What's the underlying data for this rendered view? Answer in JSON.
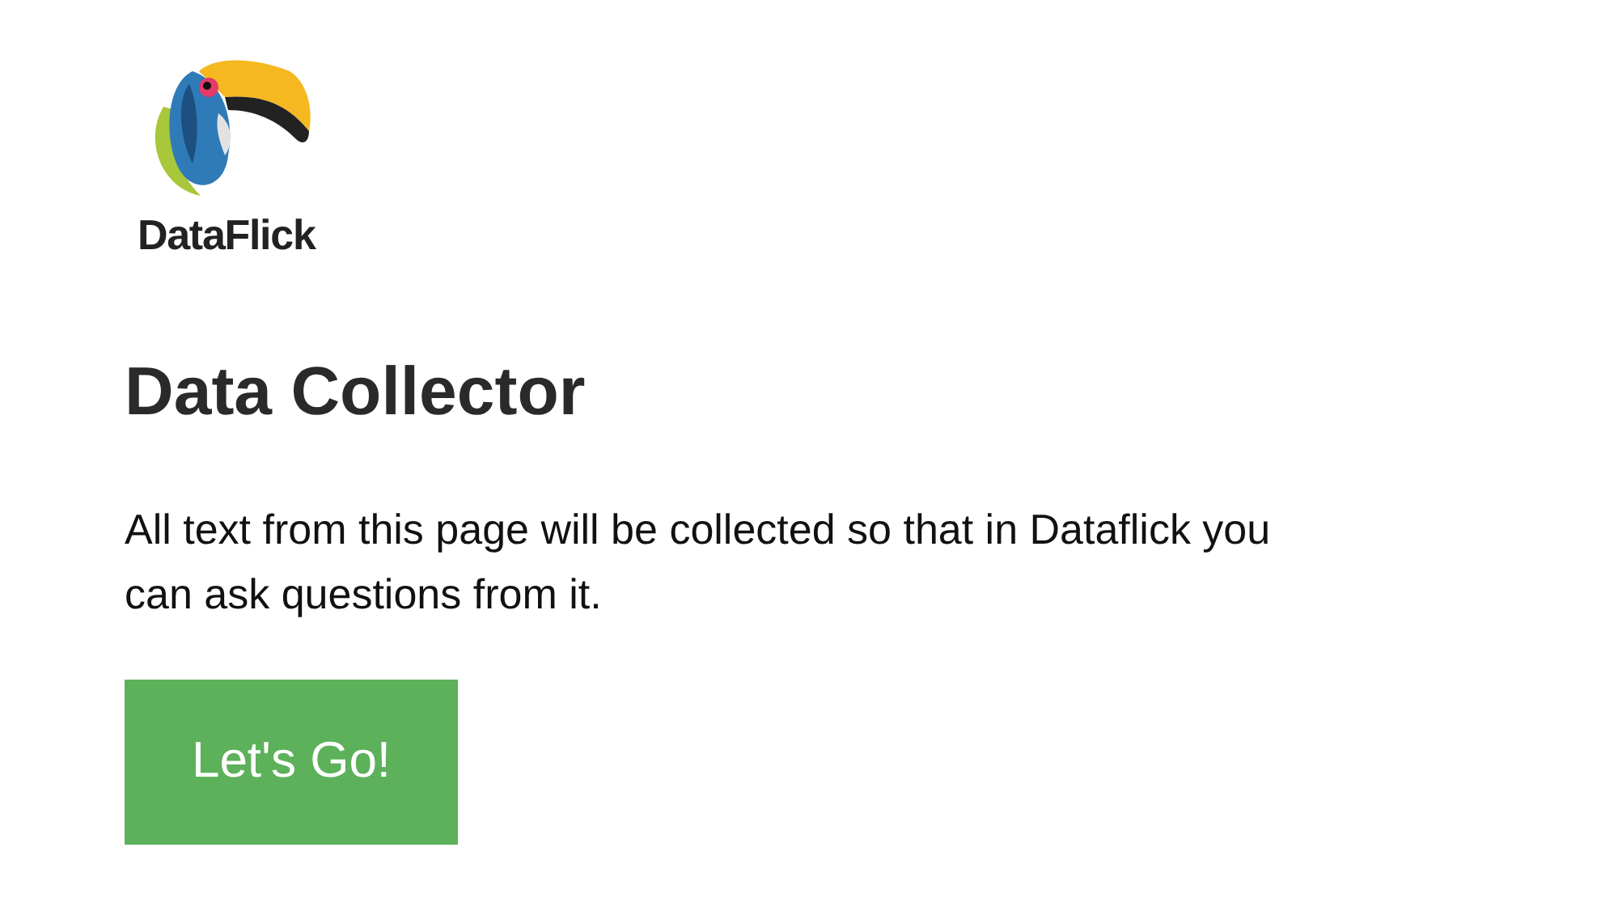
{
  "logo": {
    "text": "DataFlick"
  },
  "heading": "Data Collector",
  "description": "All text from this page will be collected so that in Dataflick you can ask questions from it.",
  "button": {
    "label": "Let's Go!"
  }
}
